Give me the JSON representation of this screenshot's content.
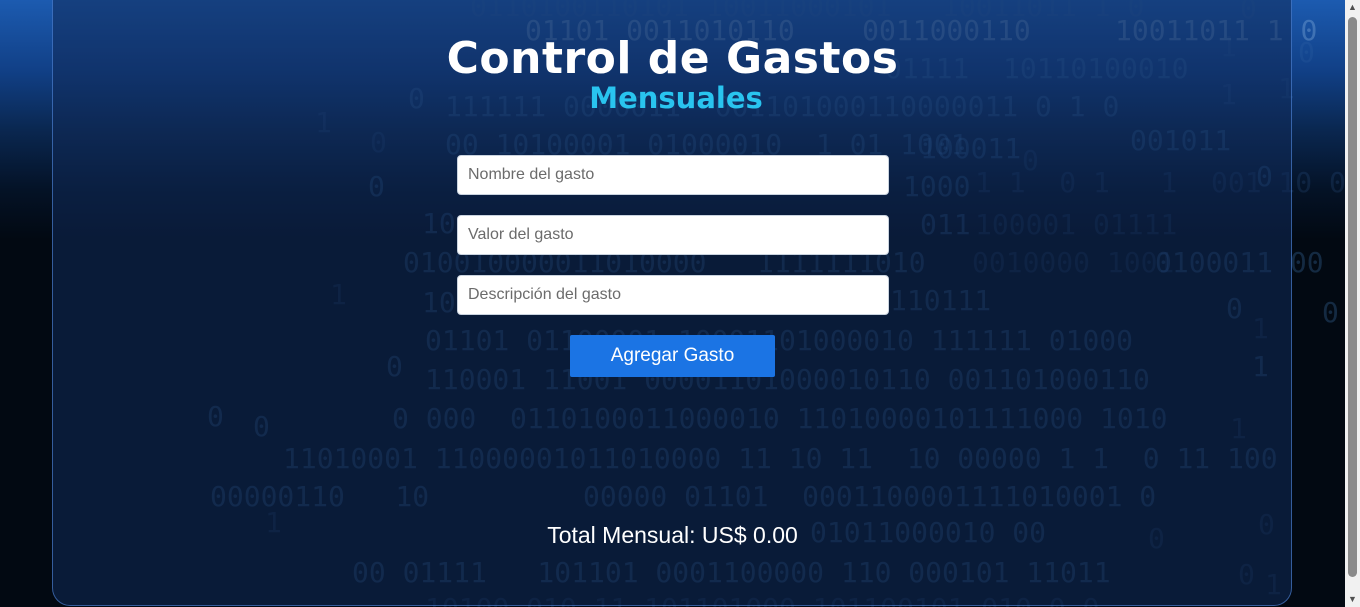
{
  "app": {
    "title": "Control de Gastos",
    "subtitle": "Mensuales"
  },
  "form": {
    "name_placeholder": "Nombre del gasto",
    "value_placeholder": "Valor del gasto",
    "description_placeholder": "Descripción del gasto",
    "name_value": "",
    "value_value": "",
    "description_value": "",
    "submit_label": "Agregar Gasto"
  },
  "summary": {
    "total_text": "Total Mensual: US$ 0.00"
  },
  "colors": {
    "accent": "#29c4ef",
    "button": "#1b74e4",
    "panel_border": "#5a96f0"
  },
  "icons": {
    "scroll_up": "triangle-up-icon",
    "scroll_down": "triangle-down-icon"
  }
}
